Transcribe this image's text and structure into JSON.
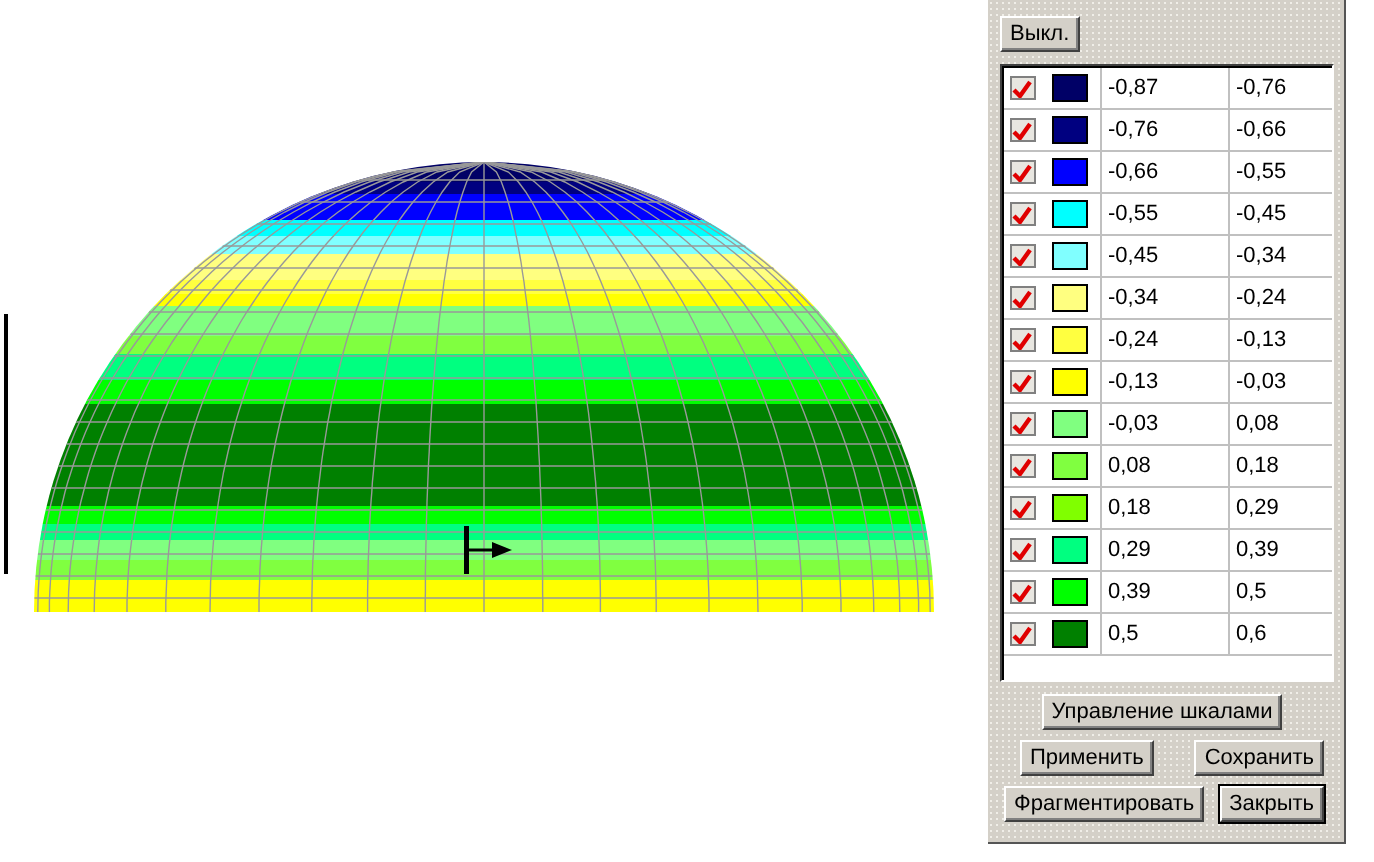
{
  "off_button": "Выкл.",
  "legend": [
    {
      "checked": true,
      "color": "#000066",
      "from": "-0,87",
      "to": "-0,76"
    },
    {
      "checked": true,
      "color": "#000080",
      "from": "-0,76",
      "to": "-0,66"
    },
    {
      "checked": true,
      "color": "#0000ff",
      "from": "-0,66",
      "to": "-0,55"
    },
    {
      "checked": true,
      "color": "#00ffff",
      "from": "-0,55",
      "to": "-0,45"
    },
    {
      "checked": true,
      "color": "#80ffff",
      "from": "-0,45",
      "to": "-0,34"
    },
    {
      "checked": true,
      "color": "#ffff80",
      "from": "-0,34",
      "to": "-0,24"
    },
    {
      "checked": true,
      "color": "#ffff40",
      "from": "-0,24",
      "to": "-0,13"
    },
    {
      "checked": true,
      "color": "#ffff00",
      "from": "-0,13",
      "to": "-0,03"
    },
    {
      "checked": true,
      "color": "#80ff80",
      "from": "-0,03",
      "to": "0,08"
    },
    {
      "checked": true,
      "color": "#80ff40",
      "from": "0,08",
      "to": "0,18"
    },
    {
      "checked": true,
      "color": "#80ff00",
      "from": "0,18",
      "to": "0,29"
    },
    {
      "checked": true,
      "color": "#00ff80",
      "from": "0,29",
      "to": "0,39"
    },
    {
      "checked": true,
      "color": "#00ff00",
      "from": "0,39",
      "to": "0,5"
    },
    {
      "checked": true,
      "color": "#008000",
      "from": "0,5",
      "to": "0,6"
    }
  ],
  "buttons": [
    "Управление шкалами",
    "Применить",
    "Сохранить",
    "Фрагментировать",
    "Закрыть"
  ]
}
